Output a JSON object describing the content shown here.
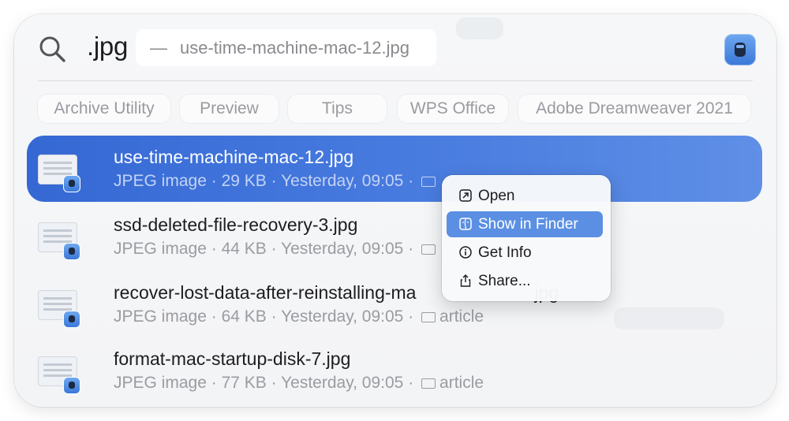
{
  "search": {
    "query": ".jpg",
    "completion_dash": "—",
    "completion_text": "use-time-machine-mac-12.jpg",
    "icon": "search-icon",
    "app_icon": "preview-app-icon"
  },
  "suggestions": [
    {
      "label": "Archive Utility"
    },
    {
      "label": "Preview"
    },
    {
      "label": "Tips"
    },
    {
      "label": "WPS Office"
    },
    {
      "label": "Adobe Dreamweaver 2021"
    }
  ],
  "results": [
    {
      "name": "use-time-machine-mac-12.jpg",
      "kind": "JPEG image",
      "size": "29 KB",
      "date": "Yesterday, 09:05",
      "folder": "",
      "selected": true
    },
    {
      "name": "ssd-deleted-file-recovery-3.jpg",
      "kind": "JPEG image",
      "size": "44 KB",
      "date": "Yesterday, 09:05",
      "folder": "",
      "selected": false
    },
    {
      "name": "recover-lost-data-after-reinstalling-ma",
      "name_tail": "jpg",
      "kind": "JPEG image",
      "size": "64 KB",
      "date": "Yesterday, 09:05",
      "folder": "article",
      "selected": false
    },
    {
      "name": "format-mac-startup-disk-7.jpg",
      "kind": "JPEG image",
      "size": "77 KB",
      "date": "Yesterday, 09:05",
      "folder": "article",
      "selected": false
    }
  ],
  "separator": " · ",
  "context_menu": {
    "items": [
      {
        "label": "Open",
        "icon": "open-arrow-icon"
      },
      {
        "label": "Show in Finder",
        "icon": "finder-icon",
        "highlighted": true
      },
      {
        "label": "Get Info",
        "icon": "info-icon"
      },
      {
        "label": "Share...",
        "icon": "share-icon"
      }
    ]
  },
  "colors": {
    "selection": "#3568d4",
    "menu_highlight": "#5b8fe3"
  }
}
